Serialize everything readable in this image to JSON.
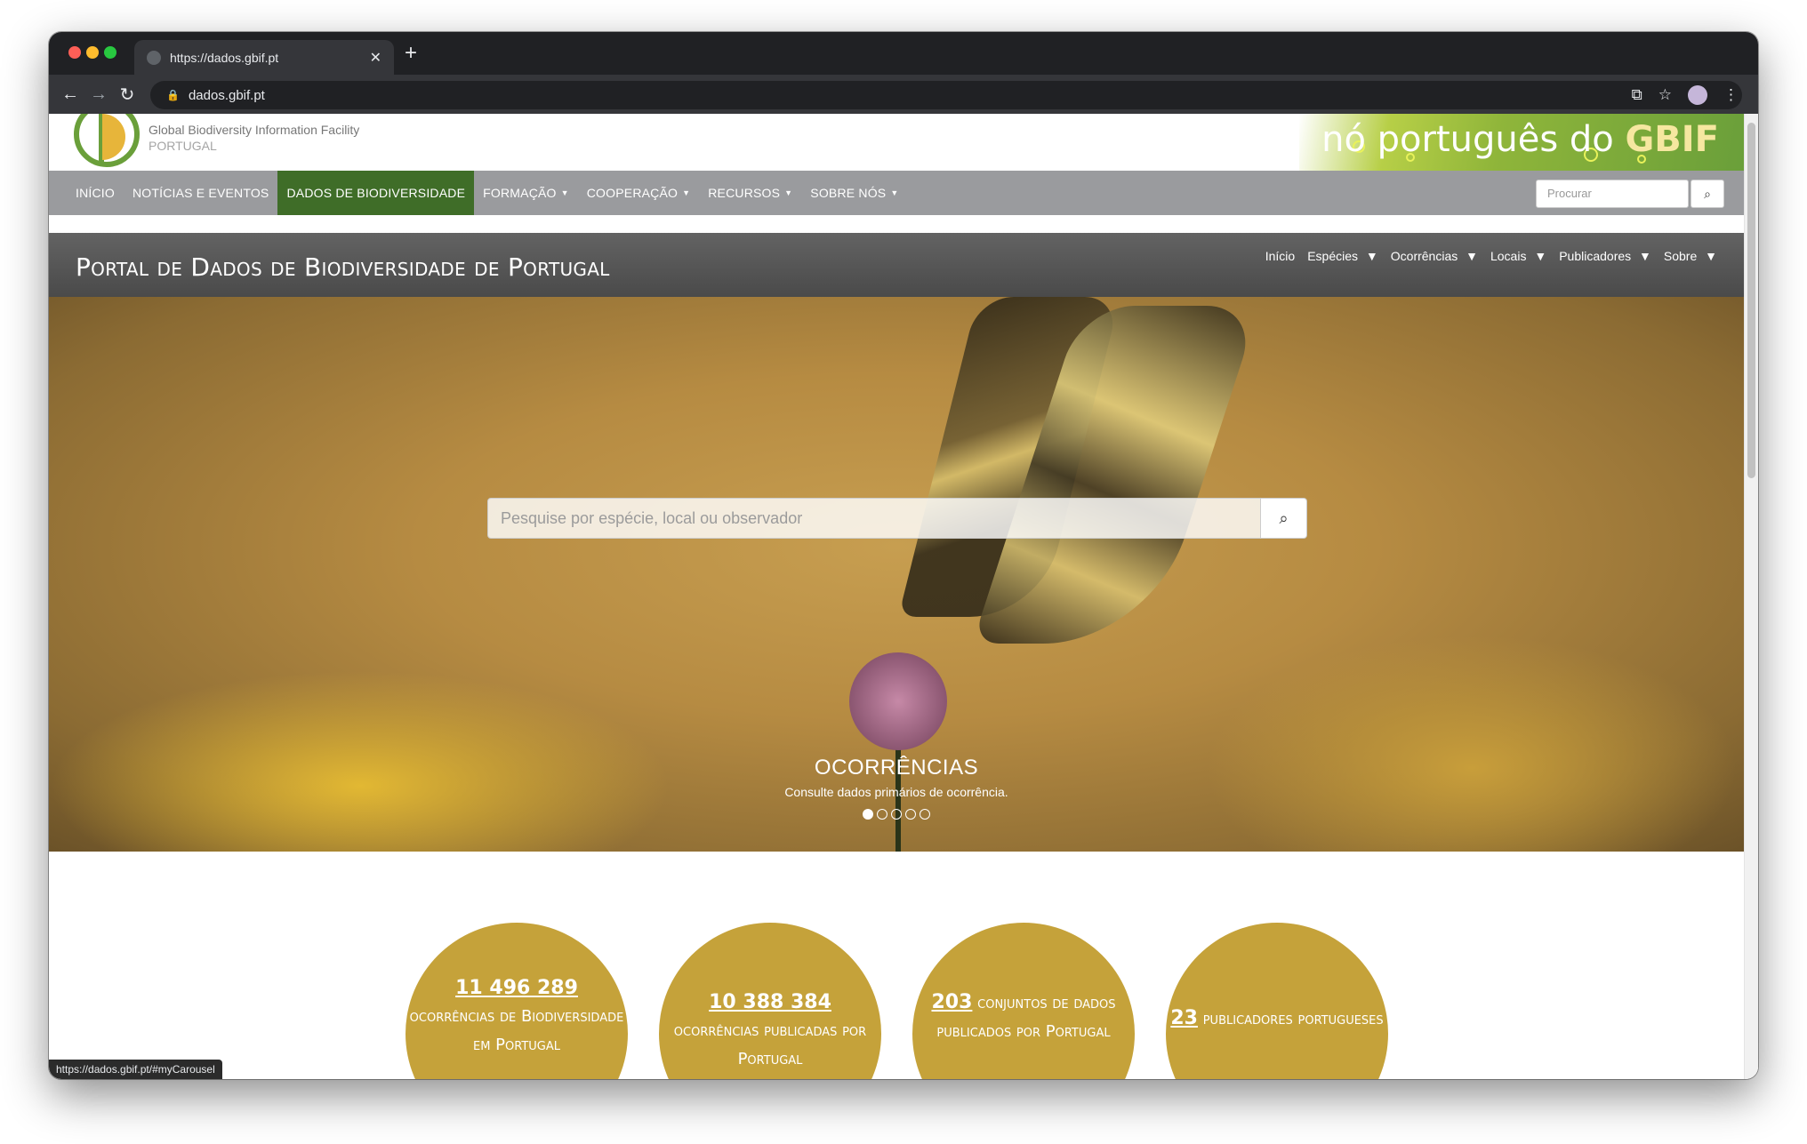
{
  "browser": {
    "tab_title": "https://dados.gbif.pt",
    "url": "dados.gbif.pt",
    "status_url": "https://dados.gbif.pt/#myCarousel"
  },
  "header": {
    "org_name": "Global Biodiversity Information Facility",
    "org_sub": "PORTUGAL",
    "banner_text": "nó português do",
    "banner_brand": "GBIF"
  },
  "main_nav": {
    "items": [
      "INÍCIO",
      "NOTÍCIAS E EVENTOS",
      "DADOS DE BIODIVERSIDADE",
      "FORMAÇÃO",
      "COOPERAÇÃO",
      "RECURSOS",
      "SOBRE NÓS"
    ],
    "search_placeholder": "Procurar"
  },
  "portal": {
    "title": "Portal de Dados de Biodiversidade de Portugal",
    "nav": [
      "Início",
      "Espécies",
      "Ocorrências",
      "Locais",
      "Publicadores",
      "Sobre"
    ]
  },
  "hero": {
    "search_placeholder": "Pesquise por espécie, local ou observador",
    "caption_title": "OCORRÊNCIAS",
    "caption_sub": "Consulte dados primários de ocorrência."
  },
  "stats": [
    {
      "number": "11 496 289",
      "text": "ocorrências de Biodiversidade em Portugal"
    },
    {
      "number": "10 388 384",
      "text": "ocorrências publicadas por Portugal"
    },
    {
      "number": "203",
      "text": "conjuntos de dados publicados por Portugal"
    },
    {
      "number": "23",
      "text": "publicadores portugueses"
    }
  ],
  "colors": {
    "nav_gray": "#9a9b9e",
    "nav_active": "#3f6d28",
    "stat_gold": "#c5a23a"
  }
}
